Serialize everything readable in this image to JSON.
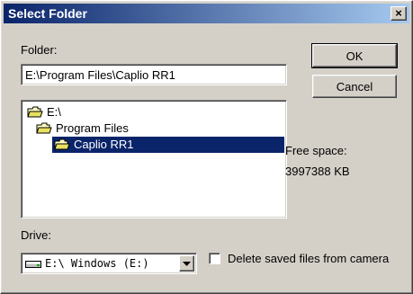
{
  "window": {
    "title": "Select Folder",
    "close_glyph": "×"
  },
  "folder": {
    "label": "Folder:",
    "value": "E:\\Program Files\\Caplio RR1"
  },
  "buttons": {
    "ok": "OK",
    "cancel": "Cancel"
  },
  "tree": {
    "items": [
      {
        "label": "E:\\",
        "icon": "open-folder-icon",
        "selected": false
      },
      {
        "label": "Program Files",
        "icon": "open-folder-icon",
        "selected": false
      },
      {
        "label": "Caplio RR1",
        "icon": "open-folder-icon",
        "selected": true
      }
    ]
  },
  "free_space": {
    "label": "Free space:",
    "value": "3997388 KB"
  },
  "drive": {
    "label": "Drive:",
    "value": "E:\\ Windows (E:)",
    "icon": "drive-icon"
  },
  "delete_option": {
    "label": "Delete saved files from camera",
    "checked": false
  },
  "colors": {
    "title_start": "#0a246a",
    "title_end": "#a6caf0",
    "selection": "#0a246a",
    "face": "#d4d0c8"
  }
}
